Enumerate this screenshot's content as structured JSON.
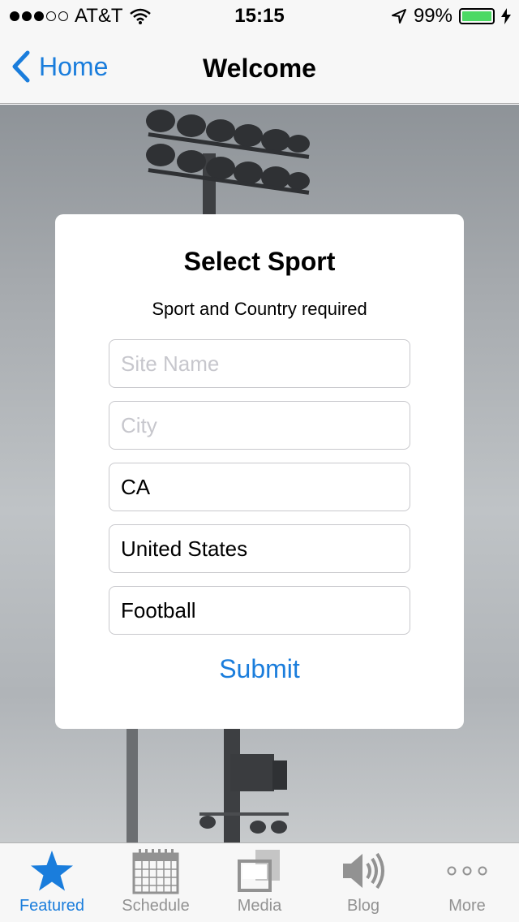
{
  "status_bar": {
    "carrier": "AT&T",
    "time": "15:15",
    "battery_percent": "99%",
    "battery_level": 0.99,
    "signal_bars_filled": 3,
    "signal_bars_total": 5
  },
  "nav": {
    "back_label": "Home",
    "title": "Welcome"
  },
  "form": {
    "title": "Select Sport",
    "subtitle": "Sport and Country required",
    "site_name": {
      "placeholder": "Site Name",
      "value": ""
    },
    "city": {
      "placeholder": "City",
      "value": ""
    },
    "state": {
      "value": "CA"
    },
    "country": {
      "value": "United States"
    },
    "sport": {
      "value": "Football"
    },
    "submit_label": "Submit"
  },
  "tabs": [
    {
      "label": "Featured",
      "icon": "star-icon",
      "active": true
    },
    {
      "label": "Schedule",
      "icon": "calendar-icon",
      "active": false
    },
    {
      "label": "Media",
      "icon": "media-icon",
      "active": false
    },
    {
      "label": "Blog",
      "icon": "speaker-icon",
      "active": false
    },
    {
      "label": "More",
      "icon": "more-icon",
      "active": false
    }
  ],
  "colors": {
    "accent": "#1a7ddc",
    "battery": "#4cd964",
    "inactive_tab": "#929292"
  }
}
